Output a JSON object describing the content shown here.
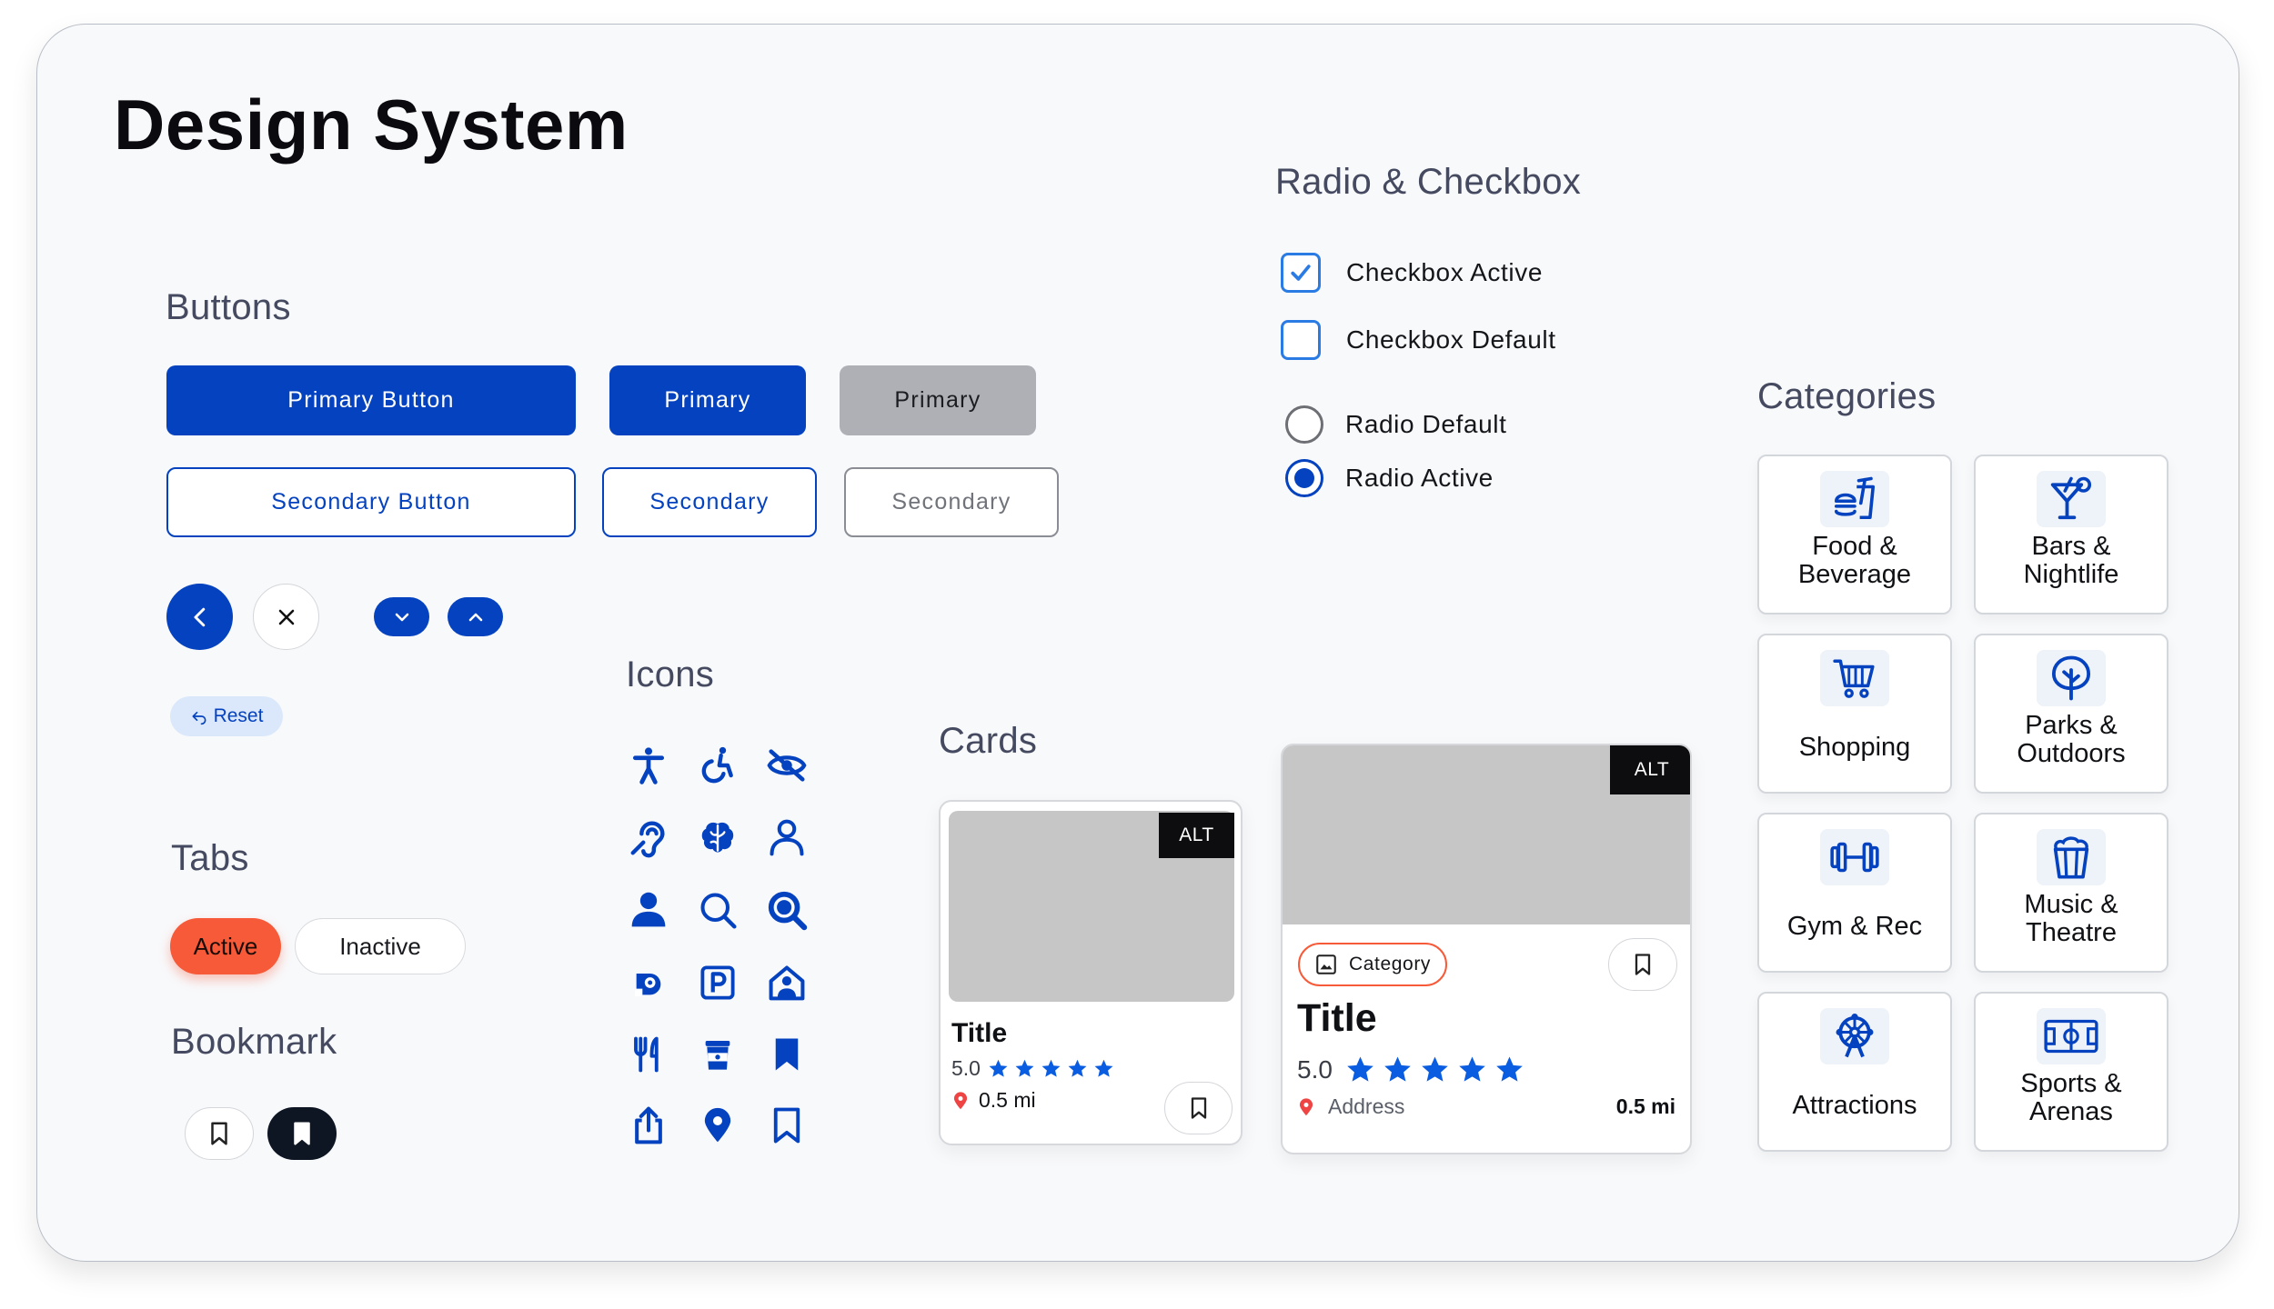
{
  "title": "Design System",
  "sections": {
    "buttons": "Buttons",
    "icons": "Icons",
    "cards": "Cards",
    "tabs": "Tabs",
    "bookmark": "Bookmark",
    "radio_checkbox": "Radio & Checkbox",
    "categories": "Categories"
  },
  "buttons": {
    "primary_large": "Primary Button",
    "primary_small": "Primary",
    "primary_disabled": "Primary",
    "secondary_large": "Secondary Button",
    "secondary_small": "Secondary",
    "secondary_disabled": "Secondary",
    "reset": "Reset"
  },
  "tabs": {
    "active": "Active",
    "inactive": "Inactive"
  },
  "checkboxes": [
    {
      "label": "Checkbox Active",
      "checked": true
    },
    {
      "label": "Checkbox Default",
      "checked": false
    }
  ],
  "radios": [
    {
      "label": "Radio Default",
      "selected": false
    },
    {
      "label": "Radio Active",
      "selected": true
    }
  ],
  "icons": [
    "accessibility-icon",
    "wheelchair-icon",
    "eye-off-icon",
    "hearing-icon",
    "brain-icon",
    "person-outline-icon",
    "person-filled-icon",
    "search-icon",
    "search-bold-icon",
    "hearing-loop-icon",
    "parking-icon",
    "home-person-icon",
    "utensils-icon",
    "coffee-cup-icon",
    "bookmark-filled-icon",
    "share-icon",
    "location-pin-icon",
    "bookmark-outline-icon"
  ],
  "card_small": {
    "alt": "ALT",
    "title": "Title",
    "rating": "5.0",
    "stars": 5,
    "distance": "0.5 mi"
  },
  "card_large": {
    "alt": "ALT",
    "category": "Category",
    "title": "Title",
    "rating": "5.0",
    "stars": 5,
    "address": "Address",
    "distance": "0.5 mi"
  },
  "categories": [
    {
      "label": "Food &\nBeverage",
      "icon": "food-icon"
    },
    {
      "label": "Bars &\nNightlife",
      "icon": "cocktail-icon"
    },
    {
      "label": "Shopping",
      "icon": "cart-icon"
    },
    {
      "label": "Parks &\nOutdoors",
      "icon": "tree-icon"
    },
    {
      "label": "Gym & Rec",
      "icon": "dumbbell-icon"
    },
    {
      "label": "Music &\nTheatre",
      "icon": "popcorn-icon"
    },
    {
      "label": "Attractions",
      "icon": "ferris-wheel-icon"
    },
    {
      "label": "Sports &\nArenas",
      "icon": "arena-icon"
    }
  ],
  "colors": {
    "primary": "#0442bf",
    "accent": "#f65a38",
    "check": "#2a7be4",
    "star": "#0a5ce0",
    "pin": "#ef4444"
  }
}
